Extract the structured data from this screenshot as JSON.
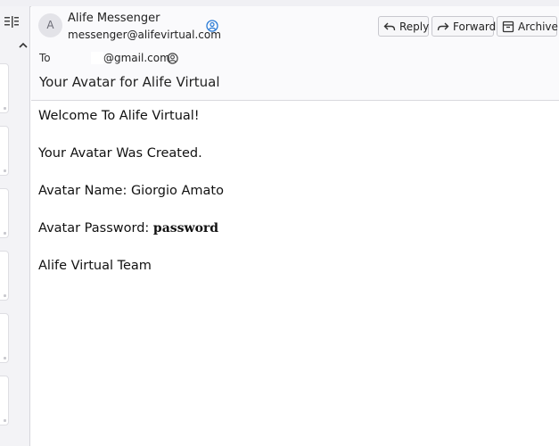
{
  "header": {
    "avatar_letter": "A",
    "sender_name": "Alife Messenger",
    "sender_email": "messenger@alifevirtual.com",
    "reply_label": "Reply",
    "forward_label": "Forward",
    "archive_label": "Archive",
    "to_label": "To",
    "to_email": "@gmail.com",
    "subject": "Your Avatar for Alife Virtual"
  },
  "body": {
    "line1": "Welcome To Alife Virtual!",
    "line2": "Your Avatar Was Created.",
    "line3": "Avatar Name: Giorgio Amato",
    "line4_label": "Avatar Password:",
    "line4_value": "password",
    "line5": "Alife Virtual Team"
  },
  "colors": {
    "contact_icon": "#2a7bd6",
    "border": "#d9d9de"
  }
}
